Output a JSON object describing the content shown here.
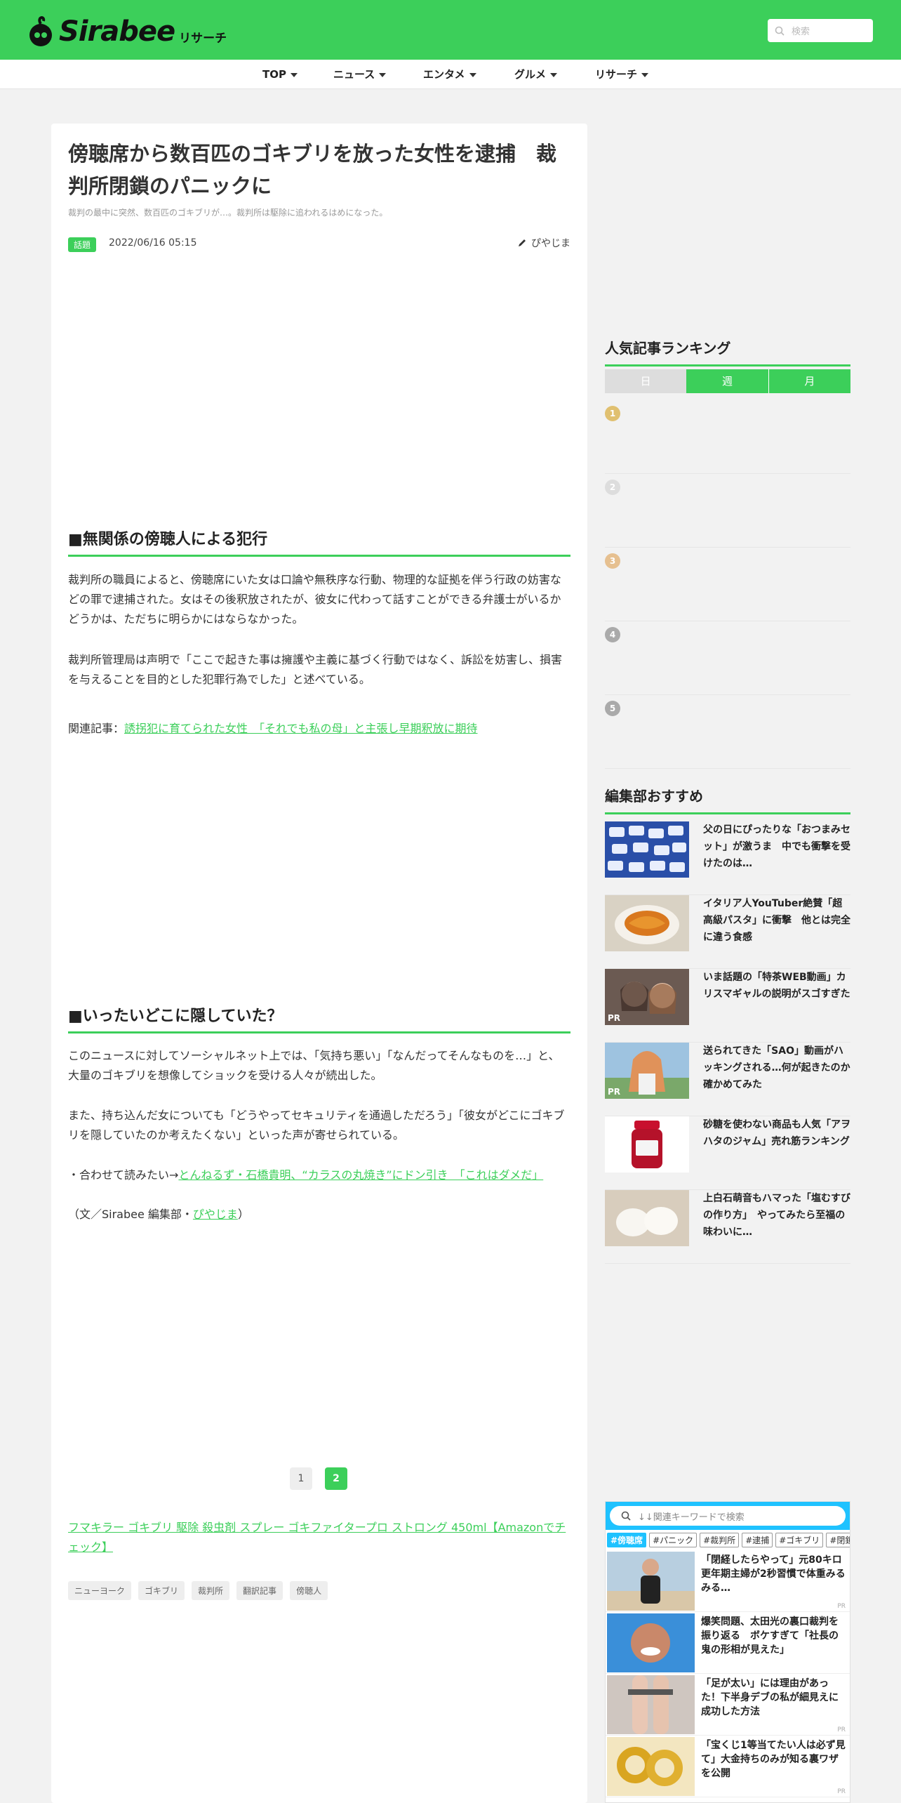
{
  "header": {
    "logo_text": "Sirabee",
    "logo_sub": "リサーチ",
    "search_placeholder": "検索"
  },
  "nav": {
    "items": [
      "TOP",
      "ニュース",
      "エンタメ",
      "グルメ",
      "リサーチ"
    ]
  },
  "article": {
    "title": "傍聴席から数百匹のゴキブリを放った女性を逮捕　裁判所閉鎖のパニックに",
    "subtitle": "裁判の最中に突然、数百匹のゴキブリが…。裁判所は駆除に追われるはめになった。",
    "category": "話題",
    "date": "2022/06/16 05:15",
    "author": "ぴやじま",
    "section1_heading": "■無関係の傍聴人による犯行",
    "para1": "裁判所の職員によると、傍聴席にいた女は口論や無秩序な行動、物理的な証拠を伴う行政の妨害などの罪で逮捕された。女はその後釈放されたが、彼女に代わって話すことができる弁護士がいるかどうかは、ただちに明らかにはならなかった。",
    "para2": "裁判所管理局は声明で「ここで起きた事は擁護や主義に基づく行動ではなく、訴訟を妨害し、損害を与えることを目的とした犯罪行為でした」と述べている。",
    "related_prefix": "関連記事：",
    "related_link": "誘拐犯に育てられた女性　「それでも私の母」と主張し早期釈放に期待",
    "section2_heading": "■いったいどこに隠していた？",
    "para3": "このニュースに対してソーシャルネット上では、「気持ち悪い」「なんだってそんなものを…」と、大量のゴキブリを想像してショックを受ける人々が続出した。",
    "para4": "また、持ち込んだ女についても「どうやってセキュリティを通過しただろう」「彼女がどこにゴキブリを隠していたのか考えたくない」といった声が寄せられている。",
    "also_read_prefix": "・合わせて読みたい→",
    "also_read_link": "とんねるず・石橋貴明、“カラスの丸焼き”にドン引き　「これはダメだ」",
    "credit_prefix": "（文／Sirabee 編集部・",
    "credit_name": "ぴやじま",
    "credit_suffix": "）",
    "pages": [
      "1",
      "2"
    ],
    "amazon_link": "フマキラー ゴキブリ 駆除 殺虫剤 スプレー ゴキファイタープロ ストロング 450ml【Amazonでチェック】",
    "tags": [
      "ニューヨーク",
      "ゴキブリ",
      "裁判所",
      "翻訳記事",
      "傍聴人"
    ]
  },
  "sidebar": {
    "ranking_title": "人気記事ランキング",
    "tabs": [
      "日",
      "週",
      "月"
    ],
    "ranks": [
      "1",
      "2",
      "3",
      "4",
      "5"
    ],
    "rank_colors": [
      "#e0c070",
      "#dddddd",
      "#e6c090",
      "#aaaaaa",
      "#aaaaaa"
    ],
    "recommend_title": "編集部おすすめ",
    "recommend": [
      {
        "text": "父の日にぴったりな「おつまみセット」が激うま　中でも衝撃を受けたのは…",
        "pr": ""
      },
      {
        "text": "イタリア人YouTuber絶賛「超高級パスタ」に衝撃　他とは完全に違う食感",
        "pr": ""
      },
      {
        "text": "いま話題の「特茶WEB動画」カリスマギャルの説明がスゴすぎた",
        "pr": "PR"
      },
      {
        "text": "送られてきた「SAO」動画がハッキングされる…何が起きたのか確かめてみた",
        "pr": "PR"
      },
      {
        "text": "砂糖を使わない商品も人気「アヲハタのジャム」売れ筋ランキング",
        "pr": ""
      },
      {
        "text": "上白石萌音もハマった「塩むすびの作り方」　やってみたら至福の味わいに…",
        "pr": ""
      }
    ]
  },
  "widget": {
    "search_placeholder": "↓↓関連キーワードで検索",
    "tags": [
      "#傍聴席",
      "#パニック",
      "#裁判所",
      "#逮捕",
      "#ゴキブリ",
      "#閉鎖"
    ],
    "items": [
      {
        "text": "「閉経したらやって」元80キロ更年期主婦が2秒習慣で体重みるみる…",
        "pr": "PR"
      },
      {
        "text": "爆笑問題、太田光の裏口裁判を振り返る　ボケすぎて「社長の鬼の形相が見えた」",
        "pr": ""
      },
      {
        "text": "「足が太い」には理由があった！下半身デブの私が細見えに成功した方法",
        "pr": "PR"
      },
      {
        "text": "「宝くじ1等当てたい人は必ず見て」大金持ちのみが知る裏ワザを公開",
        "pr": "PR"
      }
    ]
  },
  "colors": {
    "brand_green": "#3ccf5a",
    "widget_blue": "#1fc2ff"
  }
}
